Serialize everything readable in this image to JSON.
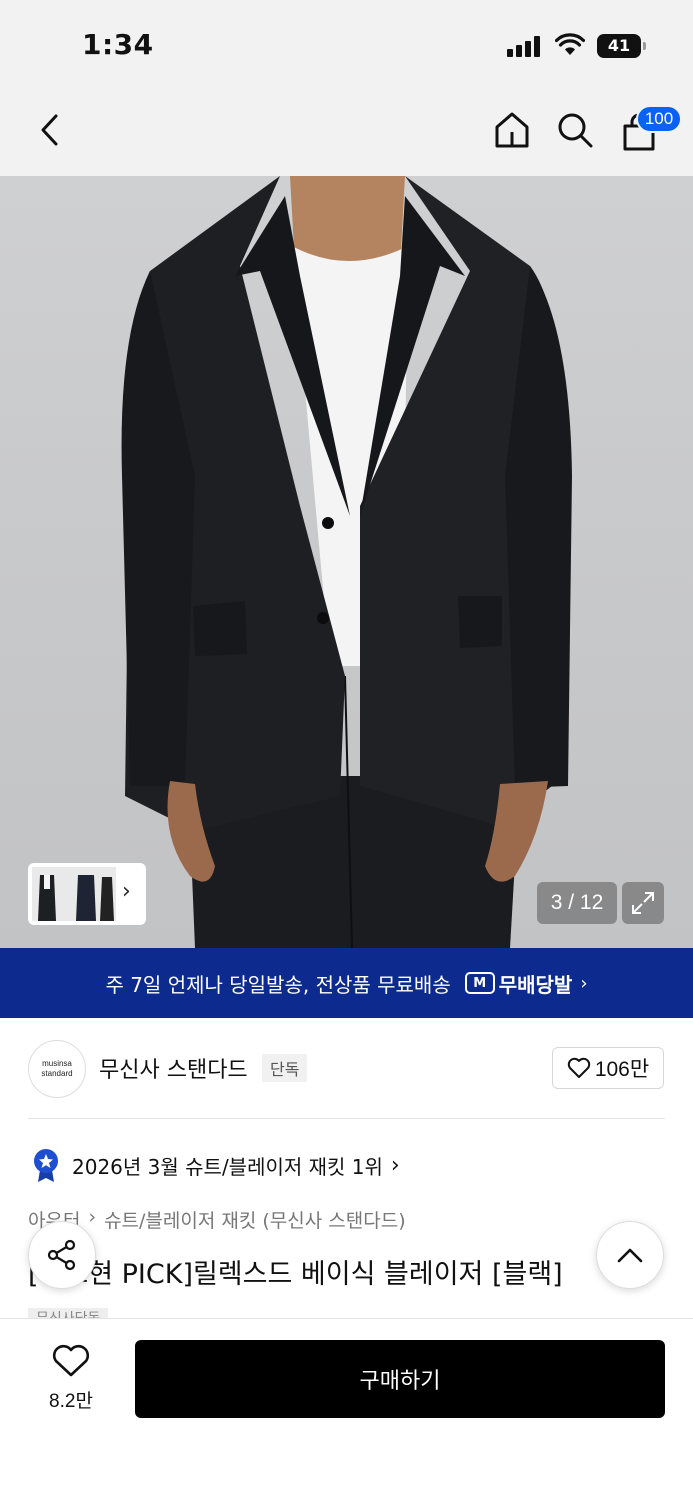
{
  "status": {
    "time": "1:34",
    "battery": "41"
  },
  "nav": {
    "cart_count": "100"
  },
  "gallery": {
    "counter": "3 / 12"
  },
  "promo": {
    "text": "주 7일 언제나 당일발송, 전상품 무료배송",
    "badge": "무배당발",
    "badge_icon": "M"
  },
  "brand": {
    "logo_line1": "musinsa",
    "logo_line2": "standard",
    "name": "무신사 스탠다드",
    "tag": "단독",
    "likes": "106만"
  },
  "ranking": {
    "text": "2026년 3월 슈트/블레이저 재킷 1위"
  },
  "breadcrumb": {
    "category": "아우터",
    "subcategory": "슈트/블레이저 재킷 (무신사 스탠다드)"
  },
  "product": {
    "title": "[박보현 PICK]릴렉스드 베이식 블레이저 [블랙]",
    "sub_tag": "무신사단독"
  },
  "bottom": {
    "wish_count": "8.2만",
    "buy_label": "구매하기"
  },
  "colors": {
    "accent_blue": "#0a61f5",
    "promo_navy": "#0d2b8f",
    "buy_black": "#000000"
  }
}
